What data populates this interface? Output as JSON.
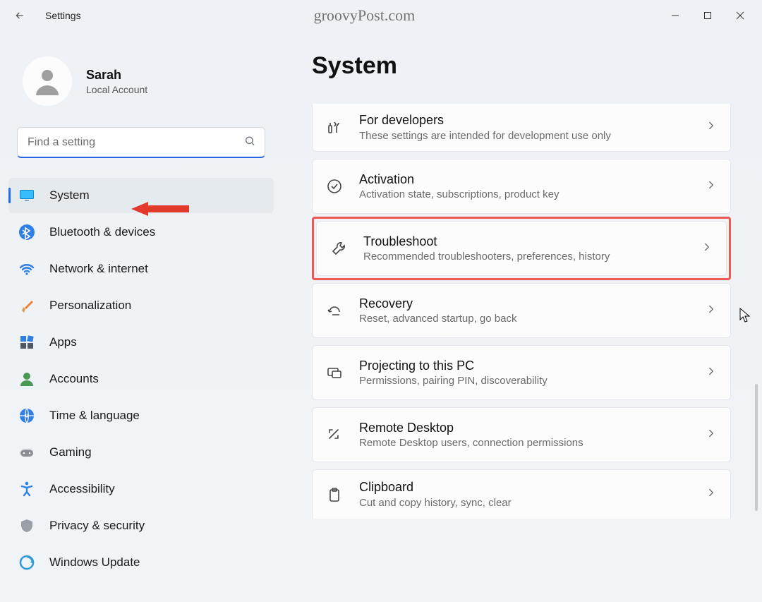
{
  "titlebar": {
    "title": "Settings"
  },
  "watermark": "groovyPost.com",
  "profile": {
    "name": "Sarah",
    "sub": "Local Account"
  },
  "search": {
    "placeholder": "Find a setting"
  },
  "nav": {
    "items": [
      {
        "label": "System",
        "icon": "display",
        "active": true
      },
      {
        "label": "Bluetooth & devices",
        "icon": "bluetooth"
      },
      {
        "label": "Network & internet",
        "icon": "wifi"
      },
      {
        "label": "Personalization",
        "icon": "brush"
      },
      {
        "label": "Apps",
        "icon": "apps"
      },
      {
        "label": "Accounts",
        "icon": "account"
      },
      {
        "label": "Time & language",
        "icon": "globe"
      },
      {
        "label": "Gaming",
        "icon": "gamepad"
      },
      {
        "label": "Accessibility",
        "icon": "accessibility"
      },
      {
        "label": "Privacy & security",
        "icon": "shield"
      },
      {
        "label": "Windows Update",
        "icon": "update"
      }
    ]
  },
  "main": {
    "title": "System",
    "cards": [
      {
        "icon": "developer",
        "title": "For developers",
        "sub": "These settings are intended for development use only"
      },
      {
        "icon": "activation",
        "title": "Activation",
        "sub": "Activation state, subscriptions, product key"
      },
      {
        "icon": "troubleshoot",
        "title": "Troubleshoot",
        "sub": "Recommended troubleshooters, preferences, history",
        "highlighted": true
      },
      {
        "icon": "recovery",
        "title": "Recovery",
        "sub": "Reset, advanced startup, go back"
      },
      {
        "icon": "projecting",
        "title": "Projecting to this PC",
        "sub": "Permissions, pairing PIN, discoverability"
      },
      {
        "icon": "remote",
        "title": "Remote Desktop",
        "sub": "Remote Desktop users, connection permissions"
      },
      {
        "icon": "clipboard",
        "title": "Clipboard",
        "sub": "Cut and copy history, sync, clear"
      }
    ]
  },
  "annotations": {
    "arrow_color": "#e33a2e",
    "highlight_color": "#ec5a53"
  }
}
